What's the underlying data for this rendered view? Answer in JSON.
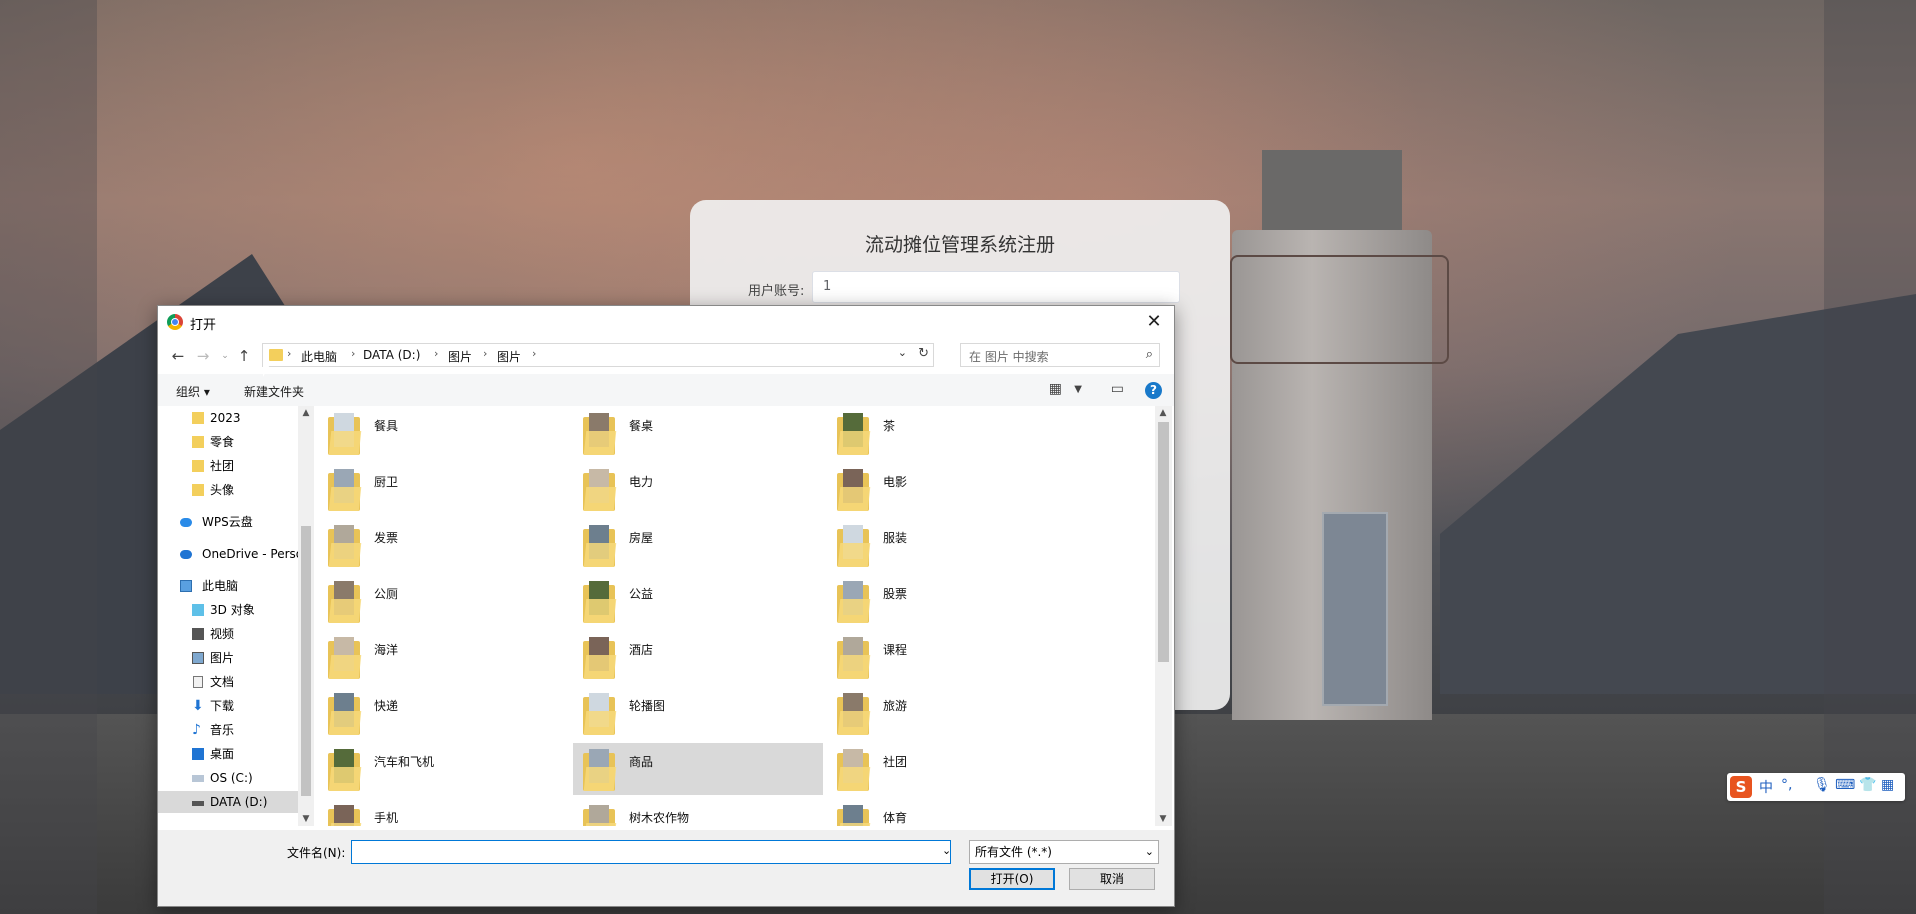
{
  "registration": {
    "title": "流动摊位管理系统注册",
    "account_label": "用户账号:",
    "account_value": "1"
  },
  "dialog": {
    "title": "打开",
    "breadcrumbs": [
      "此电脑",
      "DATA (D:)",
      "图片",
      "图片"
    ],
    "search_placeholder": "在 图片 中搜索",
    "toolbar": {
      "organize": "组织 ▾",
      "new_folder": "新建文件夹"
    },
    "nav_items": [
      {
        "label": "2023",
        "icon": "folder-icon"
      },
      {
        "label": "零食",
        "icon": "folder-icon"
      },
      {
        "label": "社团",
        "icon": "folder-icon"
      },
      {
        "label": "头像",
        "icon": "folder-icon"
      },
      {
        "label": "WPS云盘",
        "icon": "cloud-icon"
      },
      {
        "label": "OneDrive - Perso",
        "icon": "cloud-icon"
      },
      {
        "label": "此电脑",
        "icon": "computer-icon"
      },
      {
        "label": "3D 对象",
        "icon": "cube-icon"
      },
      {
        "label": "视频",
        "icon": "video-icon"
      },
      {
        "label": "图片",
        "icon": "picture-icon"
      },
      {
        "label": "文档",
        "icon": "document-icon"
      },
      {
        "label": "下载",
        "icon": "download-icon"
      },
      {
        "label": "音乐",
        "icon": "music-icon"
      },
      {
        "label": "桌面",
        "icon": "desktop-icon"
      },
      {
        "label": "OS (C:)",
        "icon": "drive-icon"
      },
      {
        "label": "DATA (D:)",
        "icon": "drive-icon"
      }
    ],
    "files": [
      "餐具",
      "餐桌",
      "茶",
      "厨卫",
      "电力",
      "电影",
      "发票",
      "房屋",
      "服装",
      "公厕",
      "公益",
      "股票",
      "海洋",
      "酒店",
      "课程",
      "快递",
      "轮播图",
      "旅游",
      "汽车和飞机",
      "商品",
      "社团",
      "手机",
      "树木农作物",
      "体育"
    ],
    "selected_file": "商品",
    "filename_label": "文件名(N):",
    "filename_value": "",
    "filetype_value": "所有文件 (*.*)",
    "open_button": "打开(O)",
    "cancel_button": "取消"
  },
  "ime": {
    "logo": "S",
    "mode": "中",
    "punct": "°,"
  }
}
